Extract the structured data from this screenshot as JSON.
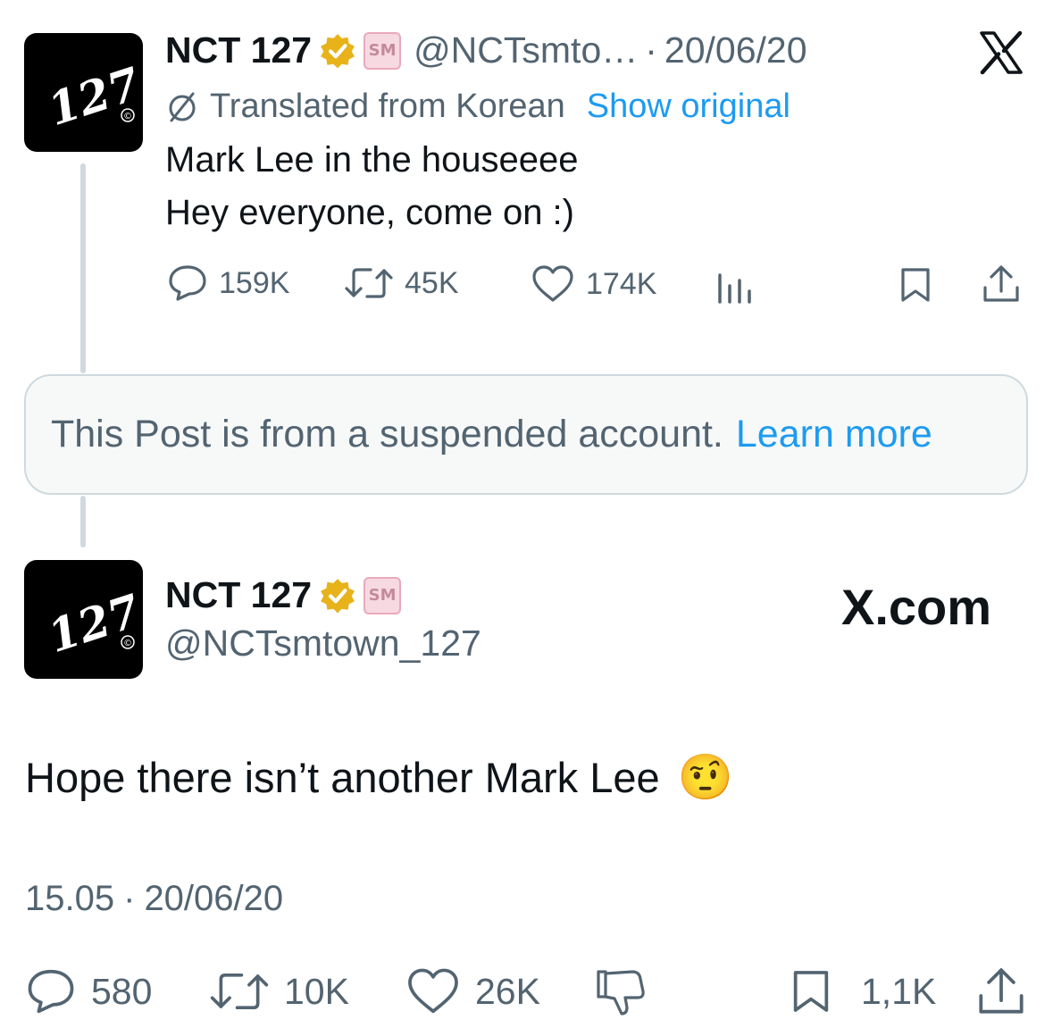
{
  "quoted_tweet": {
    "author_name": "NCT 127",
    "handle_truncated": "@NCTsmto…",
    "separator": "·",
    "date": "20/06/20",
    "translated_label": "Translated from Korean",
    "show_original": "Show original",
    "text_line1": "Mark Lee in the houseeee",
    "text_line2": "Hey everyone, come on :)",
    "replies": "159K",
    "reposts": "45K",
    "likes": "174K"
  },
  "suspended_notice": {
    "text": "This Post is from a suspended account.",
    "link": "Learn more"
  },
  "main_tweet": {
    "author_name": "NCT 127",
    "handle": "@NCTsmtown_127",
    "brand": "X.com",
    "text": "Hope there isn’t another Mark Lee",
    "emoji": "🤨",
    "time": "15.05",
    "separator": "·",
    "date": "20/06/20",
    "replies": "580",
    "reposts": "10K",
    "likes": "26K",
    "bookmarks": "1,1K"
  },
  "avatar_text": "127",
  "avatar_mark": "©",
  "badge_text": "SM",
  "colors": {
    "accent": "#1d9bf0",
    "verified": "#e8b21a",
    "text": "#0f1419",
    "secondary": "#536471",
    "border": "#cfd9de"
  },
  "icons": [
    "x-logo-icon",
    "verified-badge-icon",
    "sm-badge-icon",
    "translate-icon",
    "reply-icon",
    "repost-icon",
    "like-icon",
    "views-icon",
    "bookmark-icon",
    "share-icon",
    "dislike-icon"
  ]
}
